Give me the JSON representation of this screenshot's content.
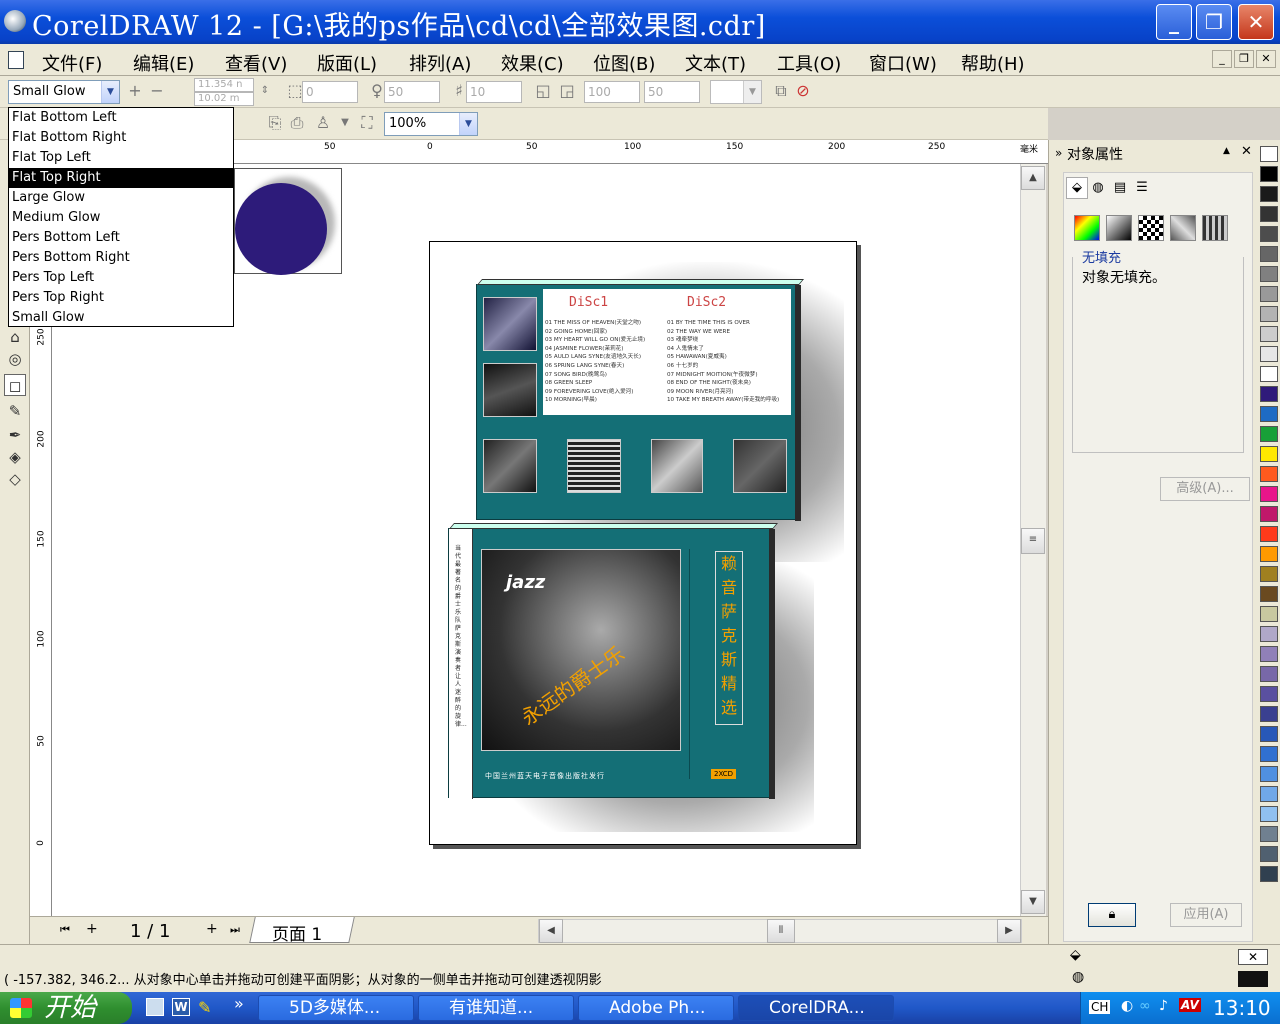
{
  "window": {
    "title": "CorelDRAW 12 - [G:\\我的ps作品\\cd\\cd\\全部效果图.cdr]",
    "minimize": "_",
    "maximize": "❐",
    "close": "✕"
  },
  "menu": [
    "文件(F)",
    "编辑(E)",
    "查看(V)",
    "版面(L)",
    "排列(A)",
    "效果(C)",
    "位图(B)",
    "文本(T)",
    "工具(O)",
    "窗口(W)",
    "帮助(H)"
  ],
  "toolbar": {
    "preset_value": "Small Glow",
    "x_value": "11.354 n",
    "y_value": "10.02 m",
    "offset_value": "0",
    "opacity_value": "50",
    "feather_value": "10",
    "fade_value": "100",
    "stretch_value": "50",
    "zoom_value": "100%"
  },
  "preset_list": {
    "items": [
      "Flat Bottom Left",
      "Flat Bottom Right",
      "Flat Top Left",
      "Flat Top Right",
      "Large Glow",
      "Medium Glow",
      "Pers Bottom Left",
      "Pers Bottom Right",
      "Pers Top Left",
      "Pers Top Right",
      "Small Glow"
    ],
    "selected": "Flat Top Right"
  },
  "ruler": {
    "h_labels": [
      "50",
      "0",
      "50",
      "100",
      "150",
      "200",
      "250",
      "毫米"
    ],
    "v_labels": [
      "250",
      "200",
      "150",
      "100",
      "50",
      "0"
    ]
  },
  "page_nav": {
    "counter": "1 / 1",
    "tab": "页面 1"
  },
  "docker": {
    "title": "对象属性",
    "fill_heading": "无填充",
    "fill_text": "对象无填充。",
    "advanced_button": "高级(A)...",
    "apply_button": "应用(A)"
  },
  "cd": {
    "disc1": "DiSc1",
    "disc2": "DiSc2",
    "disc1_tracks": [
      "01 THE MISS OF HEAVEN(天堂之吻)",
      "02 GOING HOME(回家)",
      "03 MY HEART WILL GO ON(爱无止境)",
      "04 JASMINE FLOWER(茉莉花)",
      "05 AULD LANG SYNE(友谊地久天长)",
      "06 SPRING LANG SYNE(春天)",
      "07 SONG BIRD(晚莺鸟)",
      "08 GREEN SLEEP",
      "09 FOREVERING LOVE(绝入爱河)",
      "10 MORNING(早晨)"
    ],
    "disc2_tracks": [
      "01 BY THE TIME THIS IS OVER",
      "02 THE WAY WE WERE",
      "03 魂牵梦绕",
      "04 人鬼情未了",
      "05 HAWAWAN(夏威夷)",
      "06 十七岁的",
      "07 MIDNIGHT MOITION(午夜微梦)",
      "08 END OF THE NIGHT(夜未央)",
      "09 MOON RIVER(月亮河)",
      "10 TAKE MY BREATH AWAY(带走我的呼吸)"
    ],
    "vertical_title": [
      "赖",
      "音",
      "萨",
      "克",
      "斯",
      "精",
      "选"
    ],
    "cover_script": "永远的爵士乐",
    "jazz_logo": "jazz",
    "spine_text": "当代最著名的爵士乐队萨克斯演奏者 让人迷醉的旋律...",
    "publisher": "中国兰州蓝天电子音像出版社发行",
    "badge": "2XCD"
  },
  "status": {
    "text": "( -157.382, 346.2... 从对象中心单击并拖动可创建平面阴影；从对象的一侧单击并拖动可创建透视阴影"
  },
  "taskbar": {
    "start": "开始",
    "tasks": [
      "5D多媒体...",
      "有谁知道...",
      "Adobe Ph...",
      "CorelDRA..."
    ],
    "tray_lang": "CH",
    "clock": "13:10"
  },
  "palette_colors": [
    "#ffffff",
    "#000000",
    "#1a1a1a",
    "#333333",
    "#4d4d4d",
    "#666666",
    "#808080",
    "#999999",
    "#b3b3b3",
    "#cccccc",
    "#e6e6e6",
    "#ffffff",
    "#2f1a7a",
    "#1e6bc4",
    "#18a038",
    "#ffe800",
    "#ff5a1e",
    "#e8158a",
    "#c0186a",
    "#ff3a1a",
    "#ff9a00",
    "#a08020",
    "#6a4a20",
    "#c8c8a0",
    "#b0a8c8",
    "#9080b8",
    "#7868a8",
    "#5a50a0",
    "#3a4090",
    "#2858b8",
    "#3070d0",
    "#5090e0",
    "#70a8e8",
    "#90c0f0",
    "#708090",
    "#506070",
    "#304050"
  ]
}
